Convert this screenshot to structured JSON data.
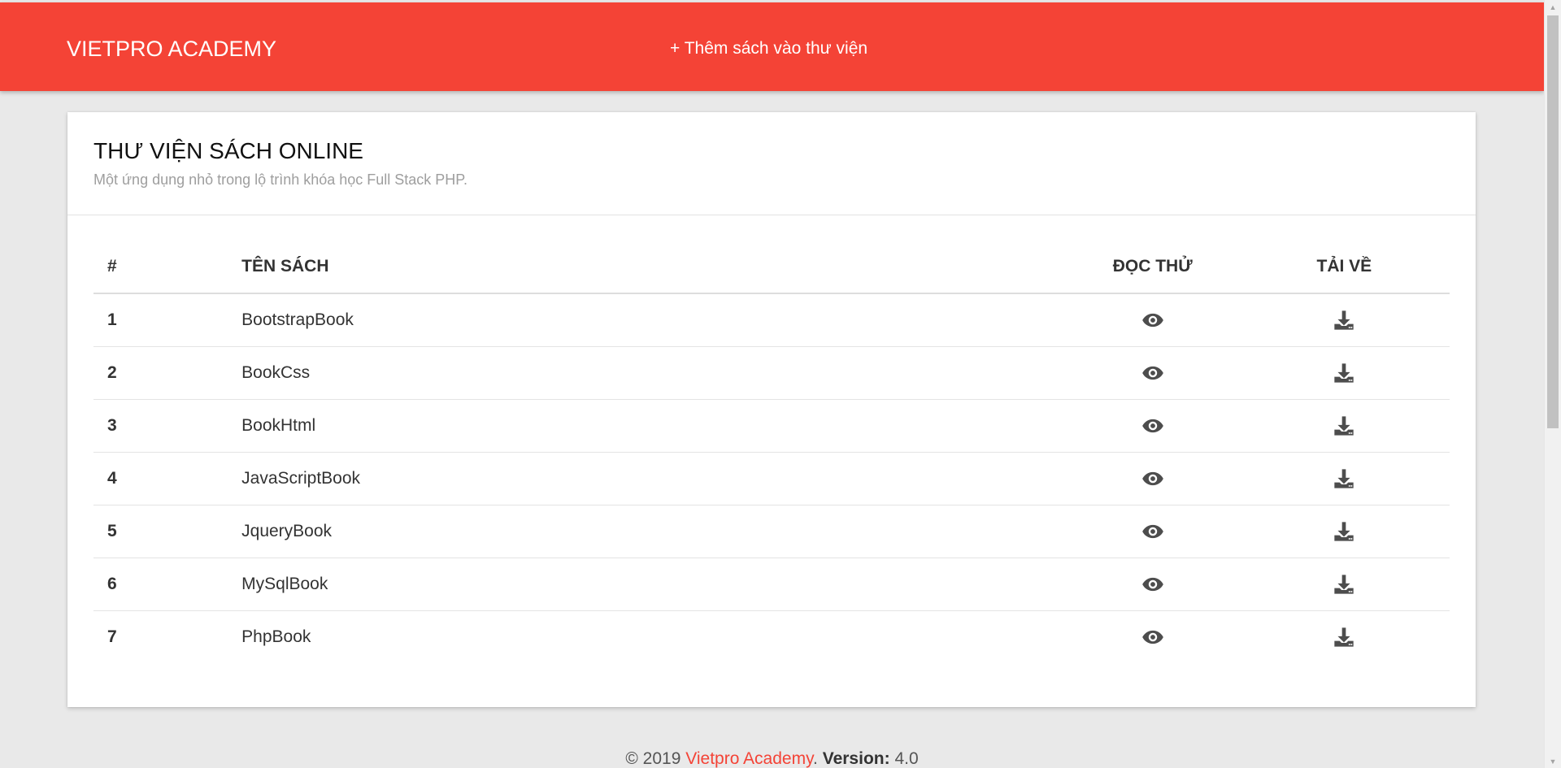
{
  "navbar": {
    "brand": "VIETPRO ACADEMY",
    "add_book_link": "+ Thêm sách vào thư viện",
    "color": "#f44336"
  },
  "card": {
    "title": "THƯ VIỆN SÁCH ONLINE",
    "subtitle": "Một ứng dụng nhỏ trong lộ trình khóa học Full Stack PHP."
  },
  "table": {
    "headers": [
      "#",
      "TÊN SÁCH",
      "ĐỌC THỬ",
      "TẢI VỀ"
    ],
    "rows": [
      {
        "num": "1",
        "name": "BootstrapBook",
        "read_icon": "eye-icon",
        "download_icon": "download-icon"
      },
      {
        "num": "2",
        "name": "BookCss",
        "read_icon": "eye-icon",
        "download_icon": "download-icon"
      },
      {
        "num": "3",
        "name": "BookHtml",
        "read_icon": "eye-icon",
        "download_icon": "download-icon"
      },
      {
        "num": "4",
        "name": "JavaScriptBook",
        "read_icon": "eye-icon",
        "download_icon": "download-icon"
      },
      {
        "num": "5",
        "name": "JqueryBook",
        "read_icon": "eye-icon",
        "download_icon": "download-icon"
      },
      {
        "num": "6",
        "name": "MySqlBook",
        "read_icon": "eye-icon",
        "download_icon": "download-icon"
      },
      {
        "num": "7",
        "name": "PhpBook",
        "read_icon": "eye-icon",
        "download_icon": "download-icon"
      }
    ]
  },
  "footer": {
    "copyright": "© 2019",
    "brand_link": "Vietpro Academy",
    "separator": ".",
    "version_label": "Version:",
    "version_value": "4.0",
    "brand_color": "#f44336"
  }
}
